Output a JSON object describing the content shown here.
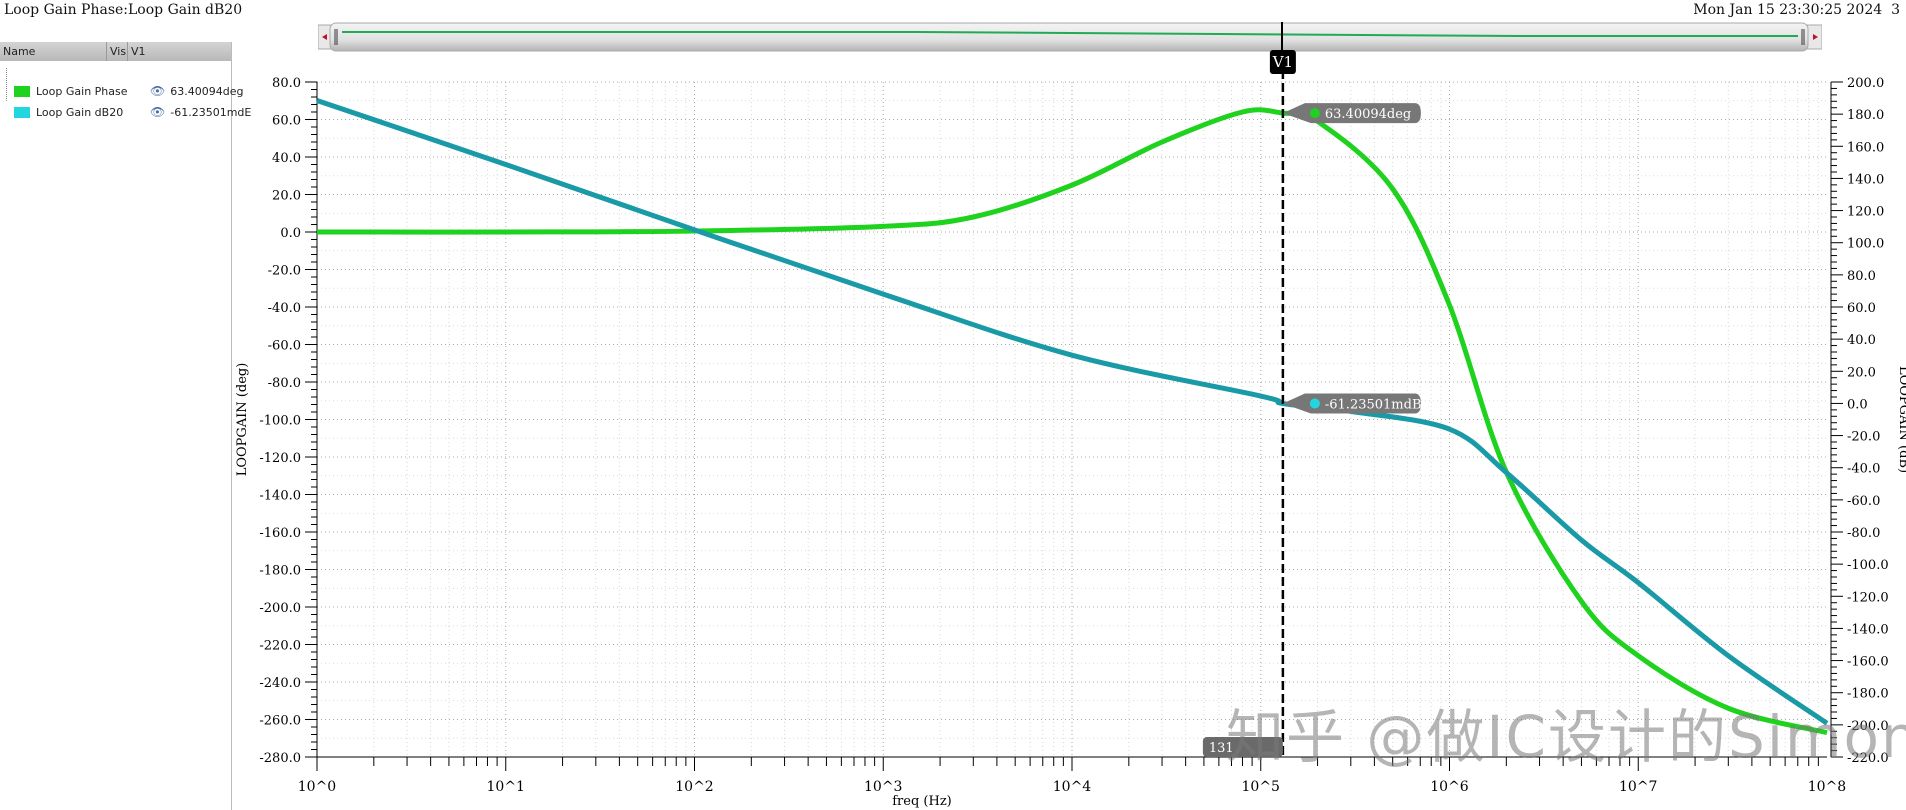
{
  "window": {
    "title": "Loop Gain Phase:Loop Gain dB20",
    "datetime": "Mon Jan 15 23:30:25 2024",
    "page_index": "3"
  },
  "legend_panel": {
    "columns": [
      "Name",
      "Vis",
      "V1"
    ],
    "items": [
      {
        "name": "Loop Gain Phase",
        "color": "#1ed21e",
        "value": "63.40094deg",
        "vis_icon": "eye-icon"
      },
      {
        "name": "Loop Gain dB20",
        "color": "#22d6e0",
        "value": "-61.23501mdE",
        "vis_icon": "eye-icon"
      }
    ]
  },
  "marker": {
    "name": "V1",
    "freq": 131000,
    "bottom_label": "131",
    "phase_readout": "63.40094deg",
    "gain_readout": "-61.23501mdB"
  },
  "watermark": "知乎 @做IC设计的Simon",
  "chart_data": {
    "type": "line",
    "xlabel": "freq (Hz)",
    "ylabel_left": "LOOPGAIN (deg)",
    "ylabel_right": "LOOPGAIN (dB)",
    "xscale": "log",
    "xlim": [
      1,
      100000000
    ],
    "x_ticks": [
      "10^0",
      "10^1",
      "10^2",
      "10^3",
      "10^4",
      "10^5",
      "10^6",
      "10^7",
      "10^8"
    ],
    "ylim_left": [
      -280,
      80
    ],
    "ylim_right": [
      -220,
      200
    ],
    "y_ticks_left": [
      "80.0",
      "60.0",
      "40.0",
      "20.0",
      "0.0",
      "-20.0",
      "-40.0",
      "-60.0",
      "-80.0",
      "-100.0",
      "-120.0",
      "-140.0",
      "-160.0",
      "-180.0",
      "-200.0",
      "-220.0",
      "-240.0",
      "-260.0",
      "-280.0"
    ],
    "y_ticks_right": [
      "200.0",
      "180.0",
      "160.0",
      "140.0",
      "120.0",
      "100.0",
      "80.0",
      "60.0",
      "40.0",
      "20.0",
      "0.0",
      "-20.0",
      "-40.0",
      "-60.0",
      "-80.0",
      "-100.0",
      "-120.0",
      "-140.0",
      "-160.0",
      "-180.0",
      "-200.0",
      "-220.0"
    ],
    "grid": true,
    "series": [
      {
        "name": "Loop Gain Phase",
        "axis": "left",
        "color": "#1ed21e",
        "x": [
          1,
          10,
          100,
          1000,
          3000,
          10000,
          30000,
          80000,
          131000,
          200000,
          500000,
          1000000,
          2000000,
          5000000,
          10000000,
          30000000,
          100000000
        ],
        "y": [
          0,
          0,
          0.5,
          3,
          8,
          25,
          48,
          64,
          63.4,
          59,
          23,
          -39,
          -128,
          -197,
          -226,
          -254,
          -267
        ]
      },
      {
        "name": "Loop Gain dB20",
        "axis": "right",
        "color": "#1a9aa6",
        "x": [
          1,
          10,
          100,
          1000,
          10000,
          100000,
          131000,
          300000,
          1000000,
          2000000,
          5000000,
          10000000,
          30000000,
          100000000
        ],
        "y": [
          188.5,
          148.7,
          108,
          68,
          30,
          4.6,
          -0.061,
          -5,
          -16,
          -43,
          -85,
          -111.5,
          -157,
          -199
        ]
      }
    ]
  }
}
